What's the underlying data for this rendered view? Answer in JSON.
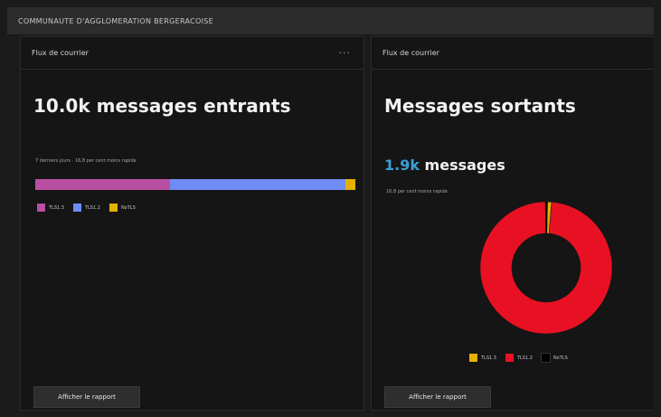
{
  "organization": "COMMUNAUTE D'AGGLOMERATION BERGERACOISE",
  "colors": {
    "background": "#1b1b1b",
    "panel": "#151515",
    "accent_blue": "#3aa0d6",
    "tls12": "#b94fa1",
    "tls12_red": "#e81123",
    "tls13": "#6f8cf5",
    "nontls": "#e6b000"
  },
  "left_card": {
    "header": "Flux de courrier",
    "more_icon": "ellipsis-icon",
    "headline": "10.0k messages entrants",
    "note": "7 derniers jours · 16,8 per cent moins rapide",
    "bar": [
      {
        "label": "TLS1.3",
        "fraction": 0.42,
        "color": "#b94fa1"
      },
      {
        "label": "TLS1.2",
        "fraction": 0.55,
        "color": "#6f8cf5"
      },
      {
        "label": "NoTLS",
        "fraction": 0.03,
        "color": "#e6b000"
      }
    ],
    "legend": [
      {
        "label": "TLS1.3",
        "color": "#b94fa1"
      },
      {
        "label": "TLS1.2",
        "color": "#6f8cf5"
      },
      {
        "label": "NoTLS",
        "color": "#e6b000"
      }
    ],
    "button": "Afficher le rapport"
  },
  "right_card": {
    "header": "Flux de courrier",
    "headline": "Messages sortants",
    "count": "1.9k",
    "count_suffix": " messages",
    "note": "16,8 per cent moins rapide",
    "donut": [
      {
        "label": "TLS1.3",
        "fraction": 0.01,
        "color": "#e6b000"
      },
      {
        "label": "TLS1.2",
        "fraction": 0.985,
        "color": "#e81123"
      },
      {
        "label": "NoTLS",
        "fraction": 0.005,
        "color": "#000000"
      }
    ],
    "legend": [
      {
        "label": "TLS1.3",
        "color": "#e6b000"
      },
      {
        "label": "TLS1.2",
        "color": "#e81123"
      },
      {
        "label": "NoTLS",
        "color": "#000000"
      }
    ],
    "button": "Afficher le rapport"
  }
}
